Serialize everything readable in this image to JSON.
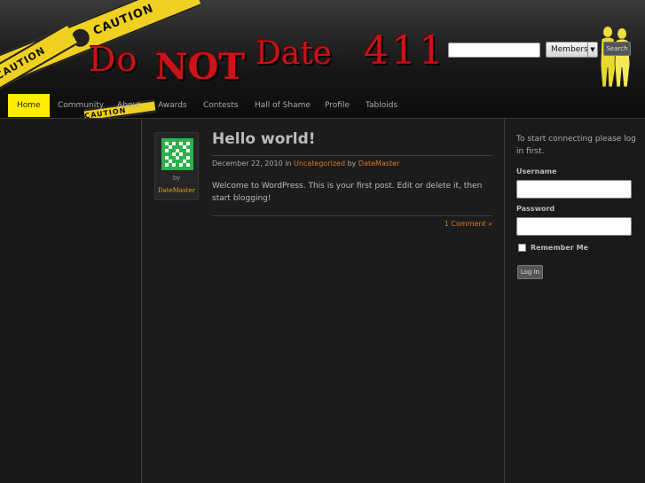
{
  "header": {
    "logo": {
      "do": "Do",
      "not": "NOT",
      "date": "Date",
      "num": "411"
    },
    "tape_text": "CAUTION",
    "search": {
      "value": "",
      "button_label": "Search"
    },
    "members_select": {
      "selected": "Members"
    }
  },
  "nav": {
    "items": [
      {
        "label": "Home",
        "active": true
      },
      {
        "label": "Community"
      },
      {
        "label": "About"
      },
      {
        "label": "Awards"
      },
      {
        "label": "Contests"
      },
      {
        "label": "Hall of Shame"
      },
      {
        "label": "Profile"
      },
      {
        "label": "Tabloids"
      }
    ]
  },
  "post": {
    "title": "Hello world!",
    "date": "December 22, 2010",
    "in_label": "in",
    "category": "Uncategorized",
    "by_label": "by",
    "author": "DateMaster",
    "body": "Welcome to WordPress. This is your first post. Edit or delete it, then start blogging!",
    "comments_link": "1 Comment »",
    "avatar_by": "by",
    "avatar_name": "DateMaster"
  },
  "sidebar": {
    "intro": "To start connecting please log in first.",
    "username_label": "Username",
    "password_label": "Password",
    "remember_label": "Remember Me",
    "login_button": "Log In"
  },
  "colors": {
    "accent": "#ffee00",
    "link": "#e07818",
    "logo_red": "#c8141a",
    "avatar_green": "#2bb24c"
  }
}
